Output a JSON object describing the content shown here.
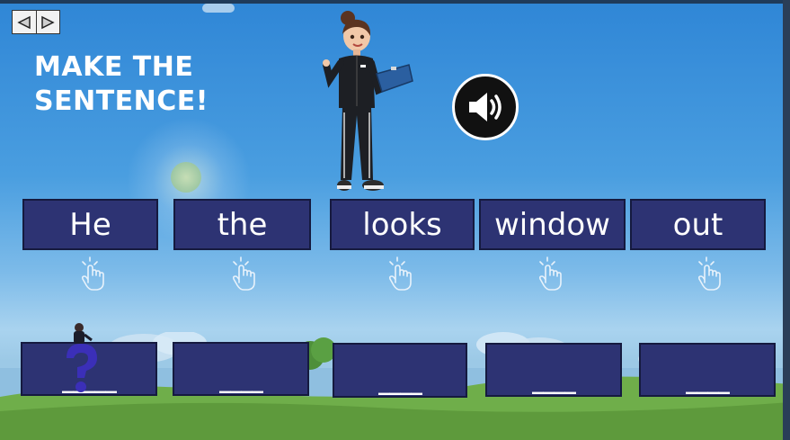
{
  "nav": {
    "prev_icon": "triangle-left-icon",
    "next_icon": "triangle-right-icon"
  },
  "title": {
    "line1": "MAKE THE",
    "line2": "SENTENCE!"
  },
  "audio": {
    "icon": "speaker-icon"
  },
  "words": [
    {
      "label": "He"
    },
    {
      "label": "the"
    },
    {
      "label": "looks"
    },
    {
      "label": "window"
    },
    {
      "label": "out"
    }
  ],
  "slots": [
    {
      "label": "_____"
    },
    {
      "label": "____"
    },
    {
      "label": "____"
    },
    {
      "label": "____"
    },
    {
      "label": "____"
    }
  ],
  "colors": {
    "tile": "#2d3373",
    "tile_border": "#151a3f",
    "text": "#ffffff",
    "sky": "#3a8fdc",
    "grass": "#5e9a3c"
  }
}
